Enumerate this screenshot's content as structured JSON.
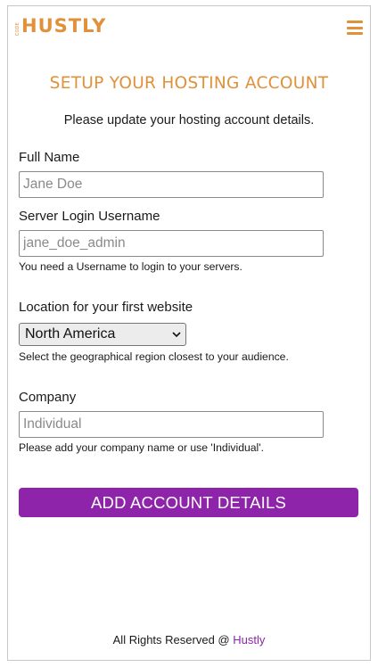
{
  "header": {
    "logo_tag": "CODE",
    "logo_text": "HUSTLY",
    "menu_icon": "hamburger-icon"
  },
  "page": {
    "title": "SETUP YOUR HOSTING ACCOUNT",
    "subtitle": "Please update your hosting account details."
  },
  "form": {
    "full_name": {
      "label": "Full Name",
      "placeholder": "Jane Doe",
      "value": ""
    },
    "username": {
      "label": "Server Login Username",
      "placeholder": "jane_doe_admin",
      "value": "",
      "help": "You need a Username to login to your servers."
    },
    "location": {
      "label": "Location for your first website",
      "selected": "North America",
      "help": "Select the geographical region closest to your audience."
    },
    "company": {
      "label": "Company",
      "placeholder": "Individual",
      "value": "",
      "help": "Please add your company name or use 'Individual'."
    },
    "submit_label": "ADD ACCOUNT DETAILS"
  },
  "footer": {
    "text": "All Rights Reserved @ ",
    "link": "Hustly"
  },
  "colors": {
    "brand_orange": "#e0913a",
    "button_purple": "#8e24aa"
  }
}
